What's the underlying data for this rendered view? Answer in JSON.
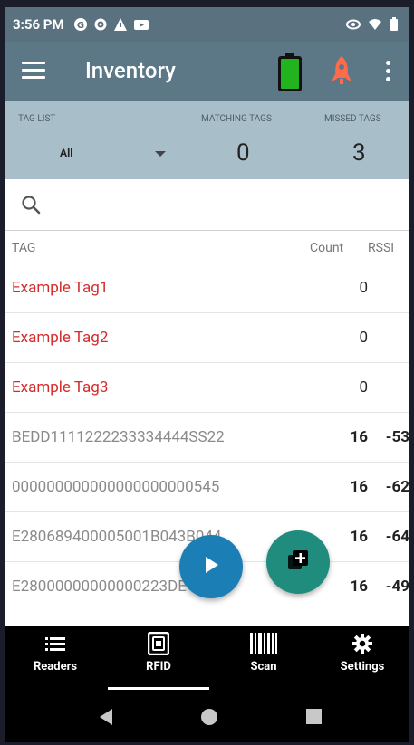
{
  "status_bar": {
    "time": "3:56 PM",
    "icons": [
      "g-icon",
      "settings-icon",
      "alert-icon",
      "media-icon"
    ],
    "right_icons": [
      "eye-icon",
      "wifi-icon",
      "battery-icon"
    ]
  },
  "app_bar": {
    "title": "Inventory",
    "battery_color": "#22b41e",
    "rocket_color": "#ff6b4a"
  },
  "filters": {
    "tag_list_label": "TAG LIST",
    "tag_list_value": "All",
    "matching_label": "MATCHING TAGS",
    "matching_value": "0",
    "missed_label": "MISSED TAGS",
    "missed_value": "3"
  },
  "search": {
    "placeholder": ""
  },
  "table": {
    "headers": {
      "tag": "TAG",
      "count": "Count",
      "rssi": "RSSI"
    },
    "rows": [
      {
        "tag": "Example Tag1",
        "count": "0",
        "rssi": "",
        "type": "missed"
      },
      {
        "tag": "Example Tag2",
        "count": "0",
        "rssi": "",
        "type": "missed"
      },
      {
        "tag": "Example Tag3",
        "count": "0",
        "rssi": "",
        "type": "missed"
      },
      {
        "tag": "BEDD1111222233334444SS22",
        "count": "16",
        "rssi": "-53",
        "type": "read"
      },
      {
        "tag": "000000000000000000000545",
        "count": "16",
        "rssi": "-62",
        "type": "read"
      },
      {
        "tag": "E280689400005001B043B044",
        "count": "16",
        "rssi": "-64",
        "type": "read"
      },
      {
        "tag": "E28000000000000223DE",
        "count": "16",
        "rssi": "-49",
        "type": "read"
      }
    ]
  },
  "bottom_nav": {
    "items": [
      {
        "label": "Readers",
        "icon": "list-icon"
      },
      {
        "label": "RFID",
        "icon": "rfid-icon",
        "selected": true
      },
      {
        "label": "Scan",
        "icon": "barcode-icon"
      },
      {
        "label": "Settings",
        "icon": "gear-icon"
      }
    ]
  }
}
